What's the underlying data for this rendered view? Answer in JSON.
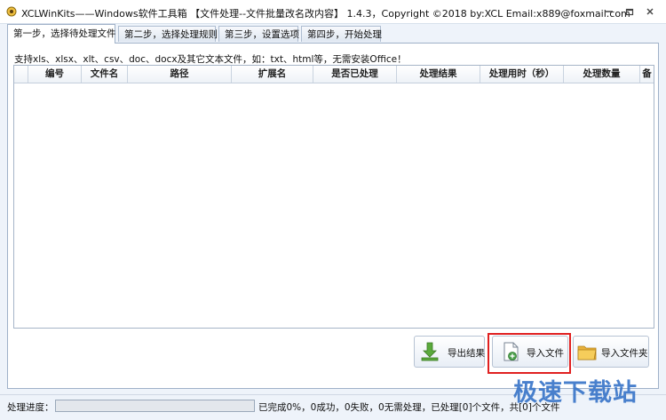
{
  "window": {
    "title": "XCLWinKits——Windows软件工具箱 【文件处理--文件批量改名改内容】 1.4.3，Copyright ©2018 by:XCL Email:x889@foxmail.com",
    "controls": [
      "minimize-icon",
      "restore-icon",
      "close-icon"
    ]
  },
  "tabs": [
    {
      "label": "第一步，选择待处理文件",
      "active": true
    },
    {
      "label": "第二步，选择处理规则",
      "active": false
    },
    {
      "label": "第三步，设置选项",
      "active": false
    },
    {
      "label": "第四步，开始处理",
      "active": false
    }
  ],
  "hint": "支持xls、xlsx、xlt、csv、doc、docx及其它文本文件，如：txt、html等，无需安装Office！",
  "table": {
    "columns": [
      "编号",
      "文件名",
      "路径",
      "扩展名",
      "是否已处理",
      "处理结果",
      "处理用时（秒）",
      "处理数量",
      "备"
    ],
    "rows": []
  },
  "buttons": {
    "export": "导出结果",
    "import_file": "导入文件",
    "import_folder": "导入文件夹"
  },
  "status": {
    "label": "处理进度：",
    "progress": 0,
    "text": "已完成0%，0成功，0失败，0无需处理，已处理[0]个文件，共[0]个文件"
  },
  "watermark": "极速下载站",
  "colors": {
    "accent_green": "#4ea14e",
    "highlight_red": "#e02020",
    "watermark_blue": "#3a76c9"
  }
}
